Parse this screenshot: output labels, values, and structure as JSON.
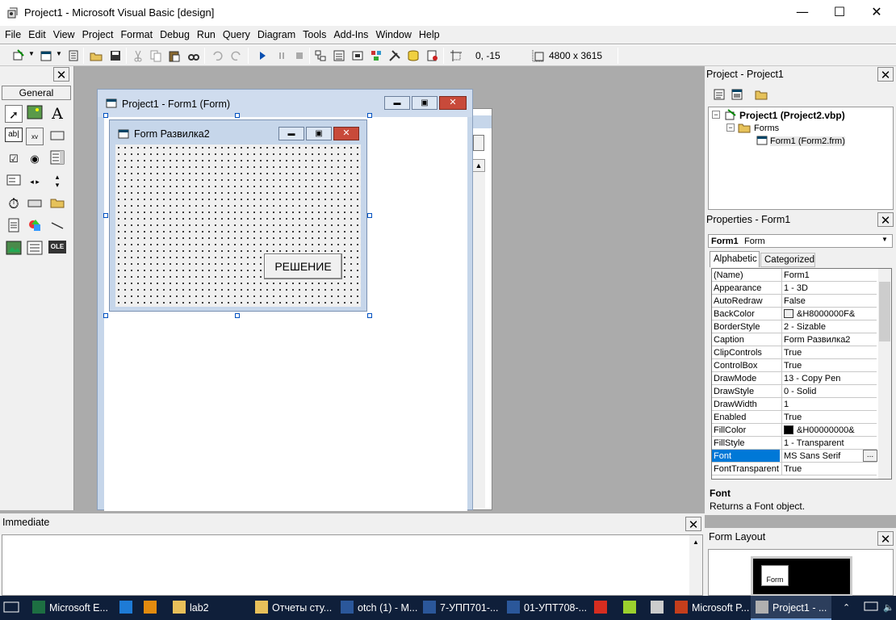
{
  "window": {
    "title": "Project1 - Microsoft Visual Basic [design]",
    "minimize": "—",
    "maximize": "☐",
    "close": "✕"
  },
  "menu": [
    "File",
    "Edit",
    "View",
    "Project",
    "Format",
    "Debug",
    "Run",
    "Query",
    "Diagram",
    "Tools",
    "Add-Ins",
    "Window",
    "Help"
  ],
  "toolbar": {
    "position": "0, -15",
    "size": "4800 x 3615"
  },
  "toolbox": {
    "tab": "General",
    "tools": [
      "pointer-icon",
      "picturebox-icon",
      "label-icon",
      "textbox-icon",
      "frame-icon",
      "commandbutton-icon",
      "checkbox-icon",
      "optionbutton-icon",
      "combobox-icon",
      "listbox-icon",
      "hscrollbar-icon",
      "vscrollbar-icon",
      "timer-icon",
      "drivelistbox-icon",
      "dirlistbox-icon",
      "filelistbox-icon",
      "shape-icon",
      "line-icon",
      "image-icon",
      "data-icon",
      "ole-icon"
    ]
  },
  "mdi": {
    "title": "Project1 - Form1 (Form)"
  },
  "form": {
    "caption": "Form Развилка2",
    "button_label": "РЕШЕНИЕ"
  },
  "project": {
    "title": "Project - Project1",
    "root": "Project1 (Project2.vbp)",
    "folder": "Forms",
    "item": "Form1 (Form2.frm)"
  },
  "properties": {
    "title": "Properties - Form1",
    "object_name": "Form1",
    "object_type": "Form",
    "tabs": [
      "Alphabetic",
      "Categorized"
    ],
    "rows": [
      {
        "name": "(Name)",
        "value": "Form1"
      },
      {
        "name": "Appearance",
        "value": "1 - 3D"
      },
      {
        "name": "AutoRedraw",
        "value": "False"
      },
      {
        "name": "BackColor",
        "value": "&H8000000F&"
      },
      {
        "name": "BorderStyle",
        "value": "2 - Sizable"
      },
      {
        "name": "Caption",
        "value": "Form Развилка2"
      },
      {
        "name": "ClipControls",
        "value": "True"
      },
      {
        "name": "ControlBox",
        "value": "True"
      },
      {
        "name": "DrawMode",
        "value": "13 - Copy Pen"
      },
      {
        "name": "DrawStyle",
        "value": "0 - Solid"
      },
      {
        "name": "DrawWidth",
        "value": "1"
      },
      {
        "name": "Enabled",
        "value": "True"
      },
      {
        "name": "FillColor",
        "value": "&H00000000&"
      },
      {
        "name": "FillStyle",
        "value": "1 - Transparent"
      },
      {
        "name": "Font",
        "value": "MS Sans Serif"
      },
      {
        "name": "FontTransparent",
        "value": "True"
      }
    ],
    "desc_title": "Font",
    "desc_text": "Returns a Font object."
  },
  "immediate": {
    "title": "Immediate"
  },
  "form_layout": {
    "title": "Form Layout",
    "mini_label": "Form"
  },
  "taskbar": [
    {
      "label": "Microsoft E...",
      "color": "#1d6f42"
    },
    {
      "label": "",
      "color": "#1e7bd6"
    },
    {
      "label": "",
      "color": "#e38b0f"
    },
    {
      "label": "lab2",
      "color": "#e8c05a"
    },
    {
      "label": "Отчеты сту...",
      "color": "#e8c05a"
    },
    {
      "label": "otch (1) - M...",
      "color": "#2b579a"
    },
    {
      "label": "7-УПП701-...",
      "color": "#2b579a"
    },
    {
      "label": "01-УПТ708-...",
      "color": "#2b579a"
    },
    {
      "label": "",
      "color": "#d62d20"
    },
    {
      "label": "",
      "color": "#9bd12e"
    },
    {
      "label": "",
      "color": "#cccccc"
    },
    {
      "label": "Microsoft P...",
      "color": "#c43e1c"
    },
    {
      "label": "Project1 - ...",
      "color": "#b0b0b0"
    }
  ]
}
